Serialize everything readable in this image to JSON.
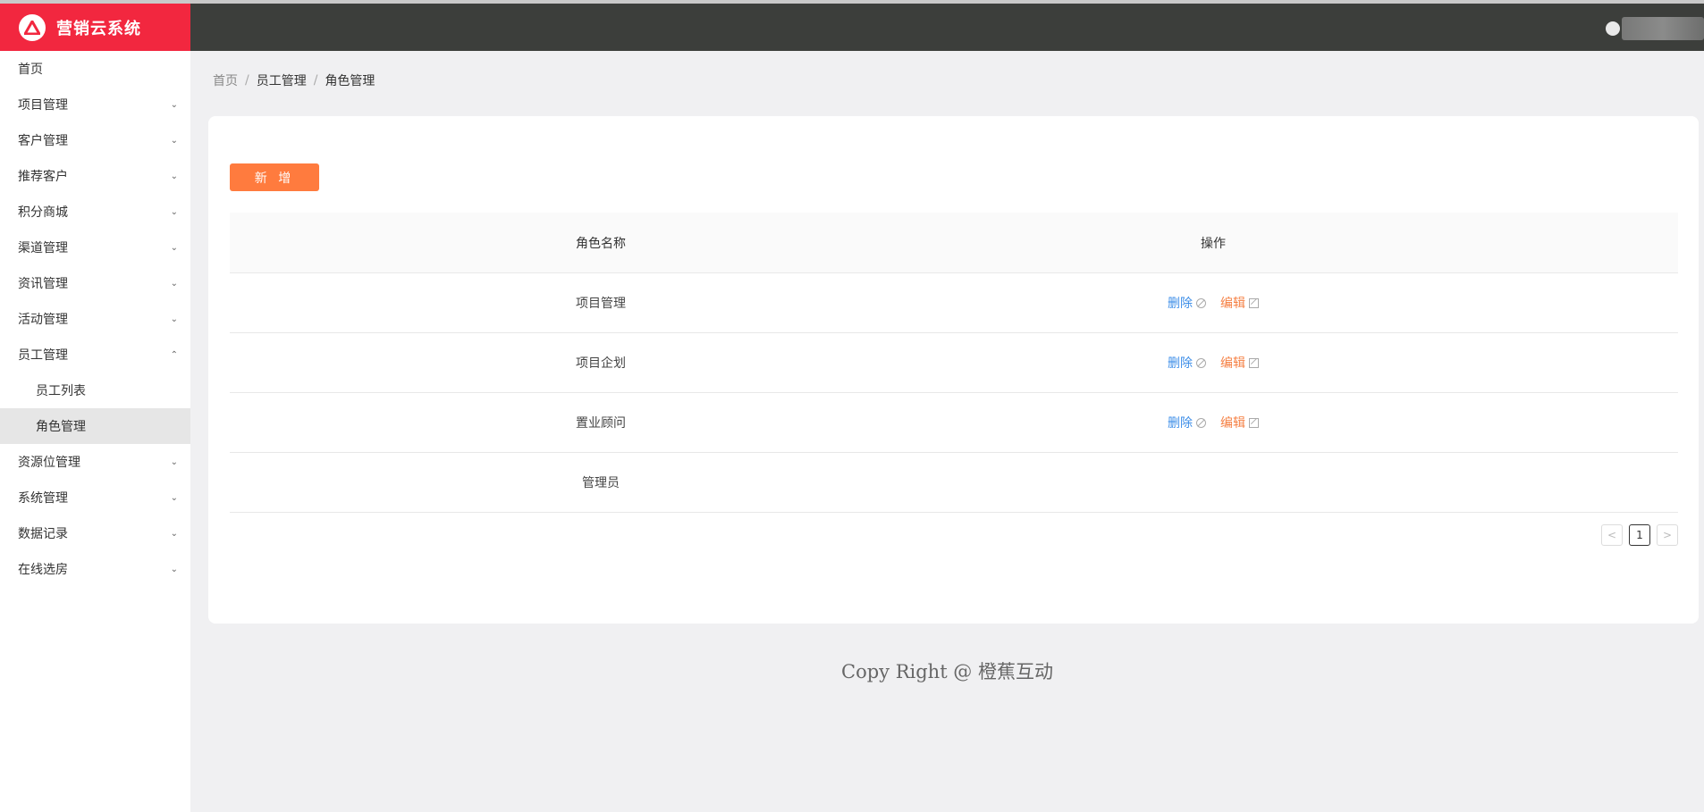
{
  "app": {
    "brand_name": "营销云系统"
  },
  "sidebar": {
    "items": [
      {
        "label": "首页",
        "chevron": ""
      },
      {
        "label": "项目管理",
        "chevron": "⌄"
      },
      {
        "label": "客户管理",
        "chevron": "⌄"
      },
      {
        "label": "推荐客户",
        "chevron": "⌄"
      },
      {
        "label": "积分商城",
        "chevron": "⌄"
      },
      {
        "label": "渠道管理",
        "chevron": "⌄"
      },
      {
        "label": "资讯管理",
        "chevron": "⌄"
      },
      {
        "label": "活动管理",
        "chevron": "⌄"
      },
      {
        "label": "员工管理",
        "chevron": "⌃"
      },
      {
        "label": "资源位管理",
        "chevron": "⌄"
      },
      {
        "label": "系统管理",
        "chevron": "⌄"
      },
      {
        "label": "数据记录",
        "chevron": "⌄"
      },
      {
        "label": "在线选房",
        "chevron": "⌄"
      }
    ],
    "subitems": [
      {
        "label": "员工列表"
      },
      {
        "label": "角色管理",
        "active": true
      }
    ]
  },
  "breadcrumb": {
    "items": [
      "首页",
      "员工管理",
      "角色管理"
    ],
    "separator": "/"
  },
  "toolbar": {
    "add_label": "新 增"
  },
  "table": {
    "headers": {
      "name": "角色名称",
      "operation": "操作"
    },
    "rows": [
      {
        "name": "项目管理",
        "delete": "删除",
        "edit": "编辑"
      },
      {
        "name": "项目企划",
        "delete": "删除",
        "edit": "编辑"
      },
      {
        "name": "置业顾问",
        "delete": "删除",
        "edit": "编辑"
      },
      {
        "name": "管理员",
        "delete": "",
        "edit": ""
      }
    ]
  },
  "pagination": {
    "prev": "<",
    "current": "1",
    "next": ">"
  },
  "footer": {
    "text": "Copy Right @ 橙蕉互动"
  },
  "colors": {
    "brand": "#f2273f",
    "topbar": "#3c3e3b",
    "accent_button": "#ff7b3e",
    "link_delete": "#3d8ee8",
    "link_edit": "#f57f42"
  },
  "icons": {
    "logo": "triangle-logo-icon",
    "chevron": "chevron-down-icon",
    "delete": "ban-icon",
    "edit": "edit-icon"
  }
}
